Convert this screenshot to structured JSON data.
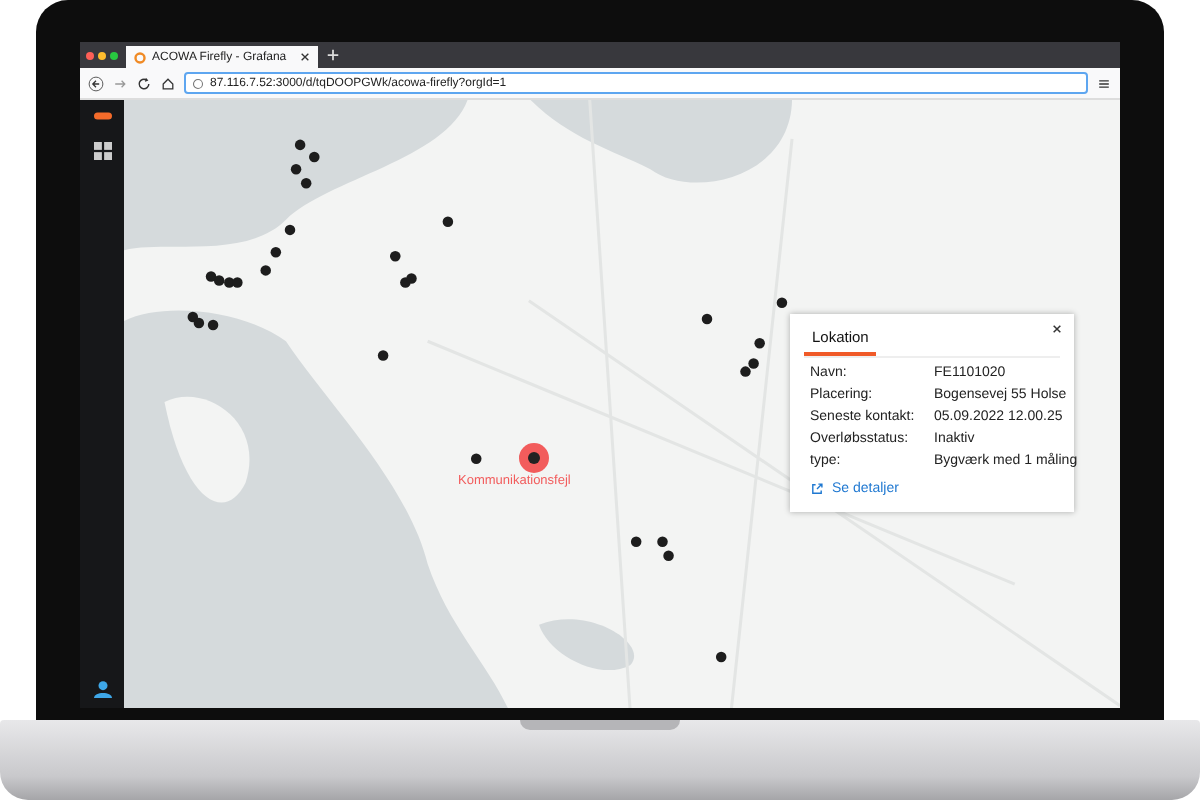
{
  "browser": {
    "tabs": [
      {
        "title": "ACOWA Firefly - Grafana",
        "selected": true
      }
    ],
    "url": "87.116.7.52:3000/d/tqDOOPGWk/acowa-firefly?orgId=1"
  },
  "map": {
    "alert_label": "Kommunikationsfejl"
  },
  "popup": {
    "tabs": [
      {
        "label": "Lokation",
        "selected": true
      }
    ],
    "fields": [
      {
        "label": "Navn:",
        "value": "FE1101020"
      },
      {
        "label": "Placering:",
        "value": "Bogensevej 55 Holse"
      },
      {
        "label": "Seneste kontakt:",
        "value": "05.09.2022 12.00.25"
      },
      {
        "label": "Overløbsstatus:",
        "value": "Inaktiv"
      },
      {
        "label": "type:",
        "value": "Bygværk med 1 måling"
      }
    ],
    "link": "Se detaljer"
  }
}
